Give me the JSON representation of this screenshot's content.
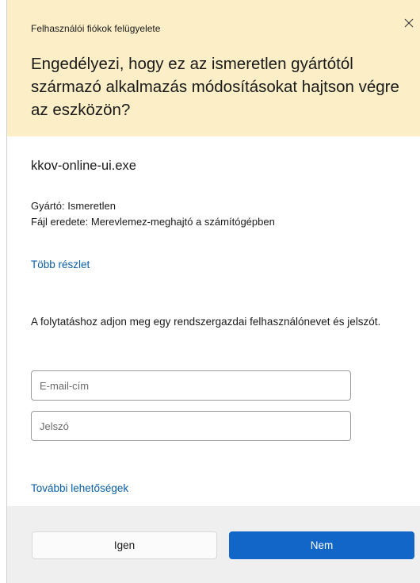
{
  "titlebar": {
    "title": "Felhasználói fiókok felügyelete",
    "close_icon": "close-icon"
  },
  "prompt": {
    "question": "Engedélyezi, hogy ez az ismeretlen gyártótól származó alkalmazás módosításokat hajtson végre az eszközön?"
  },
  "app": {
    "name": "kkov-online-ui.exe",
    "publisher": "Gyártó: Ismeretlen",
    "file_origin": "Fájl eredete: Merevlemez-meghajtó a számítógépben",
    "more_details_link": "Több részlet"
  },
  "credentials": {
    "instruction": "A folytatáshoz adjon meg egy rendszergazdai felhasználónevet és jelszót.",
    "email_placeholder": "E-mail-cím",
    "email_value": "",
    "password_placeholder": "Jelszó",
    "password_value": "",
    "more_options_link": "További lehetőségek"
  },
  "buttons": {
    "yes_label": "Igen",
    "no_label": "Nem"
  },
  "colors": {
    "header_background": "#fcefc8",
    "footer_background": "#efefef",
    "link": "#0a5ea8",
    "primary_button": "#1166c8"
  }
}
